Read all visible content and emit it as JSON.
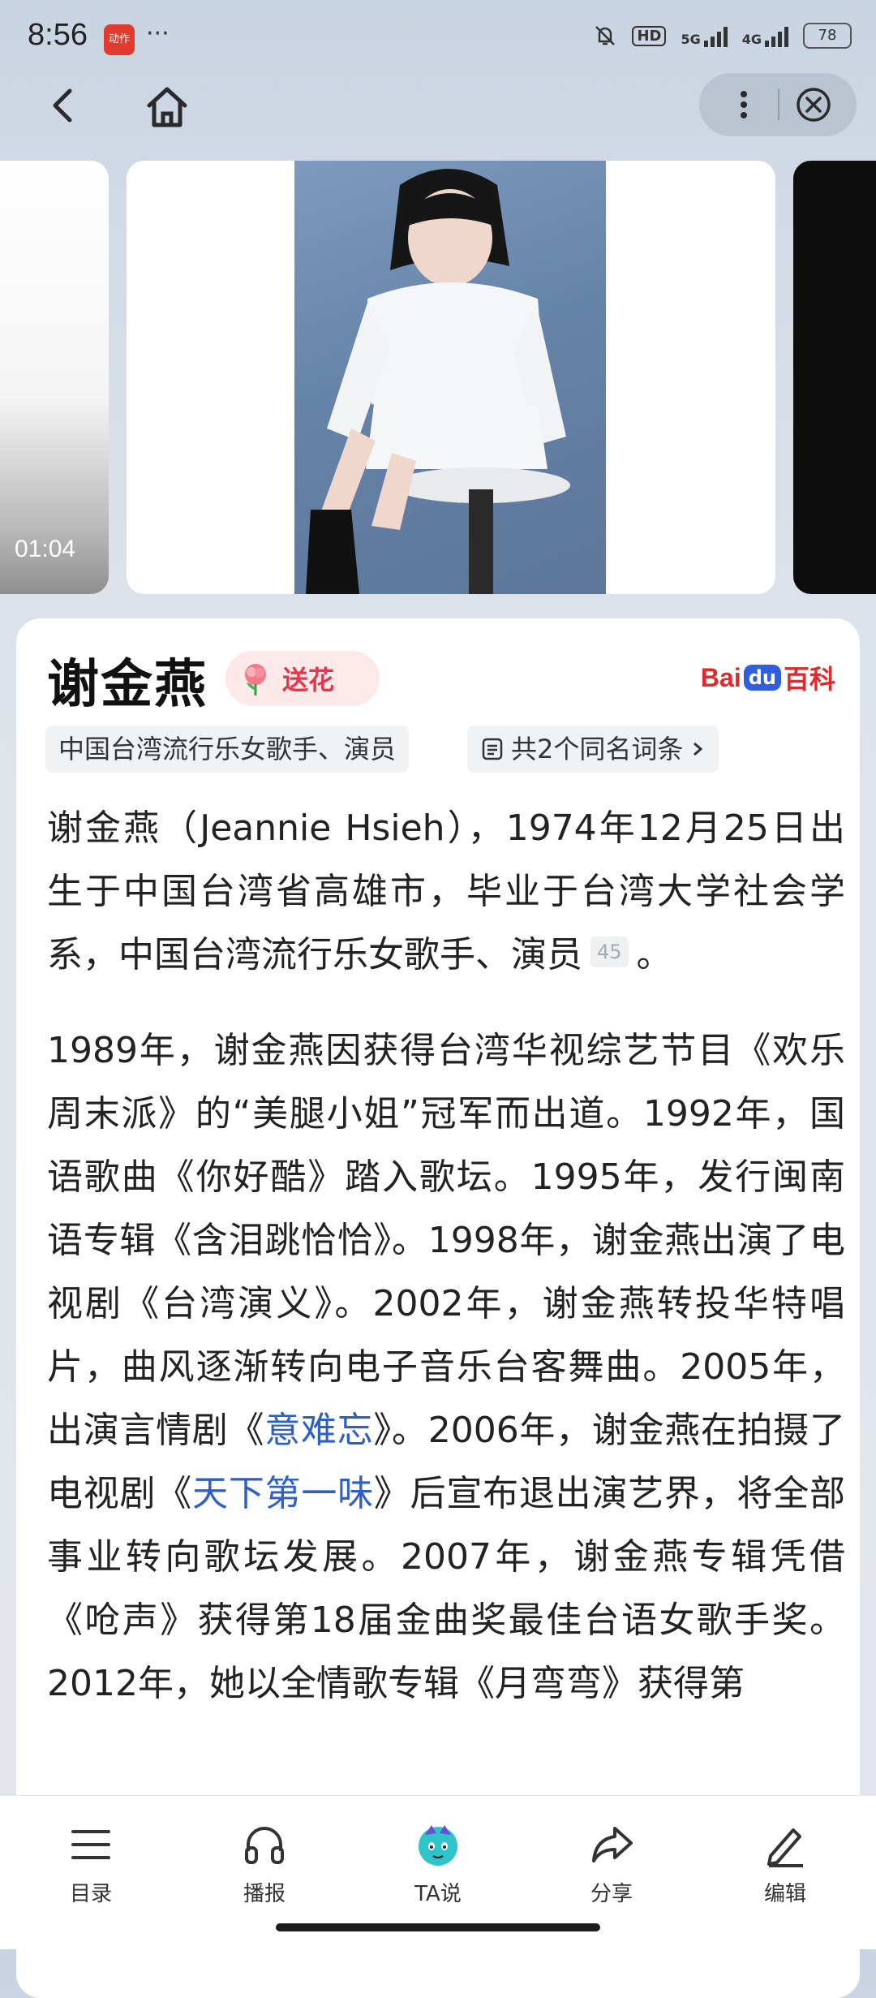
{
  "status_bar": {
    "time": "8:56",
    "app_badge": "动作",
    "more": "···",
    "network_hd": "HD",
    "net1": "5G",
    "net2": "4G",
    "battery": "78"
  },
  "nav": {
    "back_icon": "chevron-left-icon",
    "home_icon": "home-icon",
    "more_icon": "vertical-dots-icon",
    "close_icon": "circle-x-icon"
  },
  "carousel": {
    "video_duration": "01:04"
  },
  "entry": {
    "title": "谢金燕",
    "flower_label": "送花",
    "logo": {
      "bai": "Bai",
      "du": "du",
      "baike": "百科"
    },
    "description_tag": "中国台湾流行乐女歌手、演员",
    "same_name_label": "共2个同名词条",
    "para1_text": "谢金燕（Jeannie Hsieh），1974年12月25日出生于中国台湾省高雄市，毕业于台湾大学社会学系，中国台湾流行乐女歌手、演员",
    "para1_ref": "45",
    "para1_end": "。",
    "para2": {
      "t1": "1989年，谢金燕因获得台湾华视综艺节目《欢乐周末派》的“美腿小姐”冠军而出道。1992年，国语歌曲《你好酷》踏入歌坛。1995年，发行闽南语专辑《含泪跳恰恰》。1998年，谢金燕出演了电视剧《台湾演义》。2002年，谢金燕转投华特唱片，曲风逐渐转向电子音乐台客舞曲。2005年，出演言情剧《",
      "link1": "意难忘",
      "t2": "》。2006年，谢金燕在拍摄了电视剧《",
      "link2": "天下第一味",
      "t3": "》后宣布退出演艺界，将全部事业转向歌坛发展。2007年，谢金燕专辑凭借《呛声》获得第18届金曲奖最佳台语女歌手奖。2012年，她以全情歌专辑《月弯弯》获得第"
    }
  },
  "bottom_bar": {
    "items": [
      {
        "label": "目录",
        "icon": "list-icon"
      },
      {
        "label": "播报",
        "icon": "headphones-icon"
      },
      {
        "label": "TA说",
        "icon": "mascot-icon"
      },
      {
        "label": "分享",
        "icon": "share-arrow-icon"
      },
      {
        "label": "编辑",
        "icon": "pencil-icon"
      }
    ]
  },
  "colors": {
    "accent_red": "#de2a2a",
    "link_blue": "#2c5fc7",
    "flower_pink": "#e2394a"
  }
}
